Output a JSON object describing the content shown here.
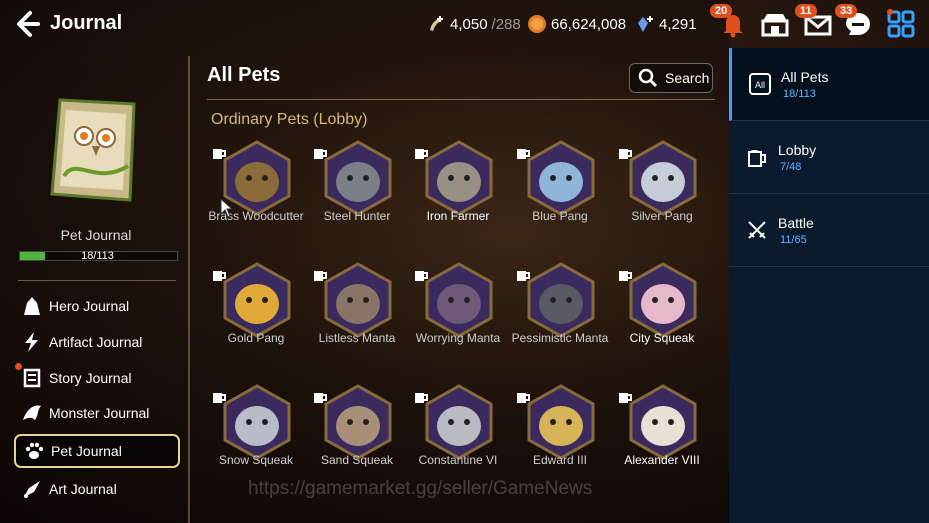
{
  "header": {
    "title": "Journal",
    "stamina": "4,050",
    "stamina_max": "/288",
    "gold": "66,624,008",
    "crystals": "4,291",
    "notif_badge": "20",
    "mail_badge": "11",
    "chat_badge": "33"
  },
  "left": {
    "journal_label": "Pet Journal",
    "progress_text": "18/113",
    "progress_fraction": 0.159,
    "menu": [
      {
        "label": "Hero Journal",
        "icon": "hero-icon"
      },
      {
        "label": "Artifact Journal",
        "icon": "artifact-icon"
      },
      {
        "label": "Story Journal",
        "icon": "story-icon"
      },
      {
        "label": "Monster Journal",
        "icon": "monster-icon"
      },
      {
        "label": "Pet Journal",
        "icon": "paw-icon"
      },
      {
        "label": "Art Journal",
        "icon": "art-icon"
      }
    ]
  },
  "main": {
    "title": "All Pets",
    "search_label": "Search",
    "section_title": "Ordinary Pets (Lobby)",
    "pets": [
      {
        "name": "Brass Woodcutter",
        "color": "#8a6b3a"
      },
      {
        "name": "Steel Hunter",
        "color": "#7a7f88"
      },
      {
        "name": "Iron Farmer",
        "color": "#9a8f84"
      },
      {
        "name": "Blue Pang",
        "color": "#8fb6d8"
      },
      {
        "name": "Silver Pang",
        "color": "#c6ccd8"
      },
      {
        "name": "Gold Pang",
        "color": "#e0a93a"
      },
      {
        "name": "Listless Manta",
        "color": "#8a7466"
      },
      {
        "name": "Worrying Manta",
        "color": "#6e5a78"
      },
      {
        "name": "Pessimistic Manta",
        "color": "#5a5a66"
      },
      {
        "name": "City Squeak",
        "color": "#e6b8cc"
      },
      {
        "name": "Snow Squeak",
        "color": "#b8bcc8"
      },
      {
        "name": "Sand Squeak",
        "color": "#a89078"
      },
      {
        "name": "Constantine VI",
        "color": "#b8bcc2"
      },
      {
        "name": "Edward III",
        "color": "#d8b458"
      },
      {
        "name": "Alexander VIII",
        "color": "#e8e0d4"
      }
    ],
    "watermark": "https://gamemarket.gg/seller/GameNews"
  },
  "tabs": [
    {
      "name": "All Pets",
      "count": "18/113",
      "icon": "all-icon"
    },
    {
      "name": "Lobby",
      "count": "7/48",
      "icon": "mug-icon"
    },
    {
      "name": "Battle",
      "count": "11/65",
      "icon": "swords-icon"
    }
  ],
  "colors": {
    "accent": "#3aa0ff",
    "progress": "#4cb83a",
    "badge": "#e0501e",
    "hex_purple": "#3a2a5e"
  }
}
